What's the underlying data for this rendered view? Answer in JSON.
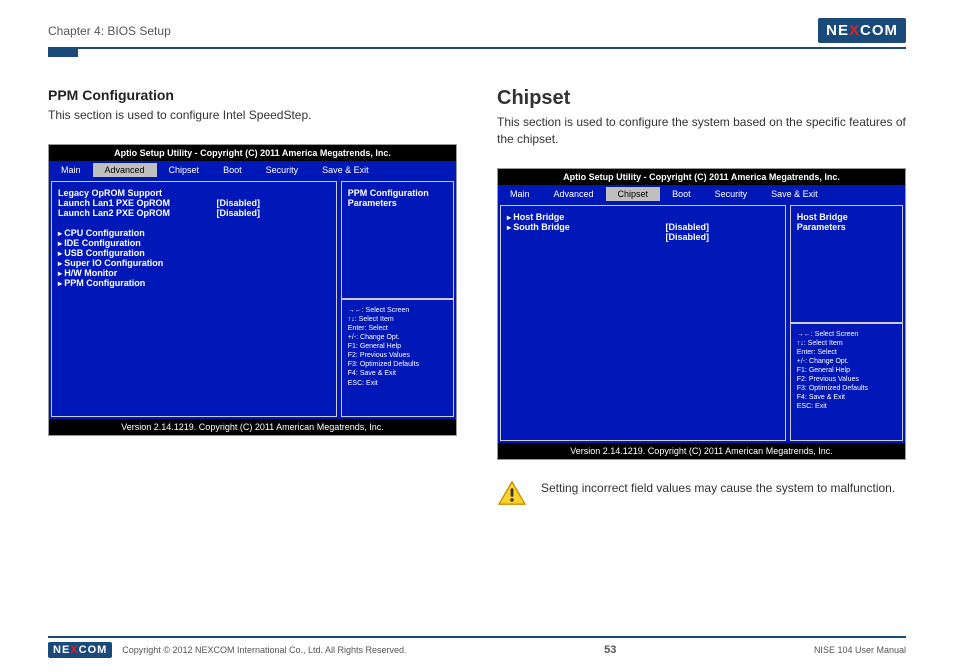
{
  "header": {
    "chapter": "Chapter 4: BIOS Setup",
    "brand_pre": "NE",
    "brand_x": "X",
    "brand_post": "COM"
  },
  "left": {
    "h2": "PPM Configuration",
    "desc": "This section is used to configure Intel SpeedStep.",
    "bios": {
      "top": "Aptio Setup Utility - Copyright (C) 2011 America Megatrends, Inc.",
      "tabs": [
        "Main",
        "Advanced",
        "Chipset",
        "Boot",
        "Security",
        "Save & Exit"
      ],
      "active": 1,
      "legacy": "Legacy OpROM Support",
      "r1a": "Launch Lan1 PXE OpROM",
      "r1b": "[Disabled]",
      "r2a": "Launch Lan2 PXE OpROM",
      "r2b": "[Disabled]",
      "m1": "CPU Configuration",
      "m2": "IDE  Configuration",
      "m3": "USB Configuration",
      "m4": "Super IO Configuration",
      "m5": "H/W Monitor",
      "m6": "PPM Configuration",
      "rt": "PPM Configuration Parameters",
      "help": [
        "→←: Select Screen",
        "↑↓: Select Item",
        "Enter: Select",
        "+/-: Change Opt.",
        "F1: General Help",
        "F2: Previous Values",
        "F3: Optimized Defaults",
        "F4: Save & Exit",
        "ESC: Exit"
      ],
      "ver": "Version 2.14.1219. Copyright (C) 2011 American Megatrends, Inc."
    }
  },
  "right": {
    "h1": "Chipset",
    "desc": "This section is used to configure the system based on the specific features of the chipset.",
    "bios": {
      "top": "Aptio Setup Utility - Copyright (C) 2011 America Megatrends, Inc.",
      "tabs": [
        "Main",
        "Advanced",
        "Chipset",
        "Boot",
        "Security",
        "Save & Exit"
      ],
      "active": 2,
      "r1a": "Host Bridge",
      "r1b": "",
      "r2a": "South Bridge",
      "r2b": "[Disabled]",
      "r3b": "[Disabled]",
      "rt": "Host Bridge Parameters",
      "help": [
        "→←: Select Screen",
        "↑↓: Select Item",
        "Enter: Select",
        "+/-: Change Opt.",
        "F1: General Help",
        "F2: Previous Values",
        "F3: Optimized Defaults",
        "F4: Save & Exit",
        "ESC: Exit"
      ],
      "ver": "Version 2.14.1219. Copyright (C) 2011 American Megatrends, Inc."
    },
    "warn": "Setting incorrect field values may cause the system to malfunction."
  },
  "footer": {
    "copy": "Copyright © 2012 NEXCOM International Co., Ltd. All Rights Reserved.",
    "page": "53",
    "manual": "NISE 104 User Manual"
  }
}
